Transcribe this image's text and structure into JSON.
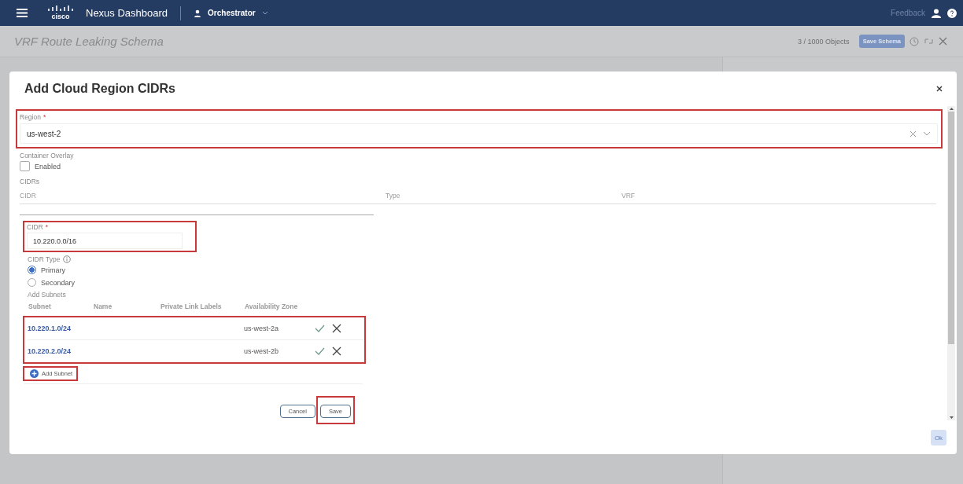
{
  "app": {
    "logo_text": "cisco",
    "brand": "Nexus Dashboard",
    "service": "Orchestrator",
    "feedback": "Feedback"
  },
  "page": {
    "title": "VRF Route Leaking Schema",
    "objects": "3 / 1000 Objects",
    "save_button": "Save Schema"
  },
  "dialog": {
    "title": "Add Cloud Region CIDRs",
    "region": {
      "label": "Region",
      "required_mark": "*",
      "value": "us-west-2",
      "highlighted": true
    },
    "container_overlay": {
      "label": "Container Overlay",
      "option": "Enabled",
      "checked": false
    },
    "cidrs_label": "CIDRs",
    "cidr_columns": [
      "CIDR",
      "Type",
      "VRF"
    ],
    "cidr_form": {
      "cidr": {
        "label": "CIDR",
        "required_mark": "*",
        "value": "10.220.0.0/16",
        "highlighted": true
      },
      "type_label": "CIDR Type",
      "types": [
        {
          "label": "Primary",
          "selected": true
        },
        {
          "label": "Secondary",
          "selected": false
        }
      ],
      "subnets_label": "Add Subnets",
      "subnet_columns": [
        "Subnet",
        "Name",
        "Private Link Labels",
        "Availability Zone"
      ],
      "subnets_highlighted": true,
      "subnets": [
        {
          "subnet": "10.220.1.0/24",
          "zone": "us-west-2a"
        },
        {
          "subnet": "10.220.2.0/24",
          "zone": "us-west-2b"
        }
      ],
      "add_subnet": {
        "label": "Add Subnet",
        "highlighted": true
      },
      "cancel": {
        "label": "Cancel",
        "highlighted": false
      },
      "save": {
        "label": "Save",
        "highlighted": true
      }
    },
    "ok": "Ok"
  }
}
